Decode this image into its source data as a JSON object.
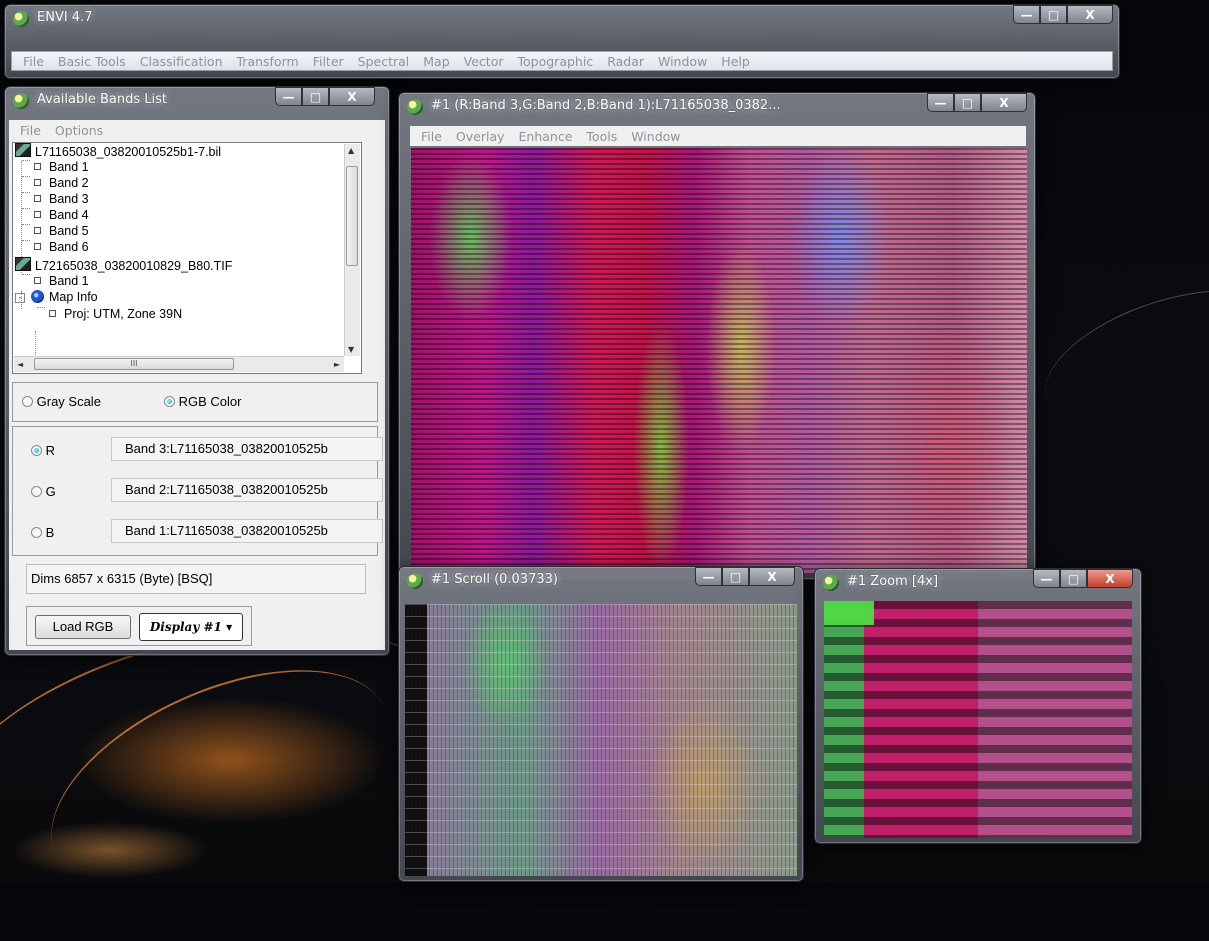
{
  "main_window": {
    "title": "ENVI 4.7",
    "menu": [
      "File",
      "Basic Tools",
      "Classification",
      "Transform",
      "Filter",
      "Spectral",
      "Map",
      "Vector",
      "Topographic",
      "Radar",
      "Window",
      "Help"
    ]
  },
  "window_controls": {
    "minimize": "—",
    "maximize": "□",
    "close": "X"
  },
  "bands_window": {
    "title": "Available Bands List",
    "menu": [
      "File",
      "Options"
    ],
    "tree": [
      {
        "label": "L71165038_03820010525b1-7.bil",
        "kind": "file"
      },
      {
        "label": "Band 1",
        "kind": "band"
      },
      {
        "label": "Band 2",
        "kind": "band"
      },
      {
        "label": "Band 3",
        "kind": "band"
      },
      {
        "label": "Band 4",
        "kind": "band"
      },
      {
        "label": "Band 5",
        "kind": "band"
      },
      {
        "label": "Band 6",
        "kind": "band"
      },
      {
        "label": "L72165038_03820010829_B80.TIF",
        "kind": "file"
      },
      {
        "label": "Band 1",
        "kind": "band"
      },
      {
        "label": "Map Info",
        "kind": "map"
      },
      {
        "label": "Proj: UTM, Zone 39N",
        "kind": "band"
      }
    ],
    "hscroll_grip": "III",
    "mode_options": [
      {
        "label": "Gray Scale",
        "selected": false
      },
      {
        "label": "RGB Color",
        "selected": true
      }
    ],
    "rgb": [
      {
        "channel": "R",
        "selected": true,
        "value": "Band 3:L71165038_03820010525b"
      },
      {
        "channel": "G",
        "selected": false,
        "value": "Band 2:L71165038_03820010525b"
      },
      {
        "channel": "B",
        "selected": false,
        "value": "Band 1:L71165038_03820010525b"
      }
    ],
    "dims": "Dims 6857 x 6315 (Byte) [BSQ]",
    "load_button": "Load RGB",
    "display_dropdown": "Display #1"
  },
  "display_window": {
    "title": "#1 (R:Band 3,G:Band 2,B:Band 1):L71165038_0382...",
    "menu": [
      "File",
      "Overlay",
      "Enhance",
      "Tools",
      "Window"
    ]
  },
  "scroll_window": {
    "title": "#1 Scroll (0.03733)"
  },
  "zoom_window": {
    "title": "#1 Zoom [4x]"
  },
  "colors": {
    "window_frame": "#6e737d",
    "accent_green": "#5ea84e",
    "close_red": "#c4402c"
  }
}
